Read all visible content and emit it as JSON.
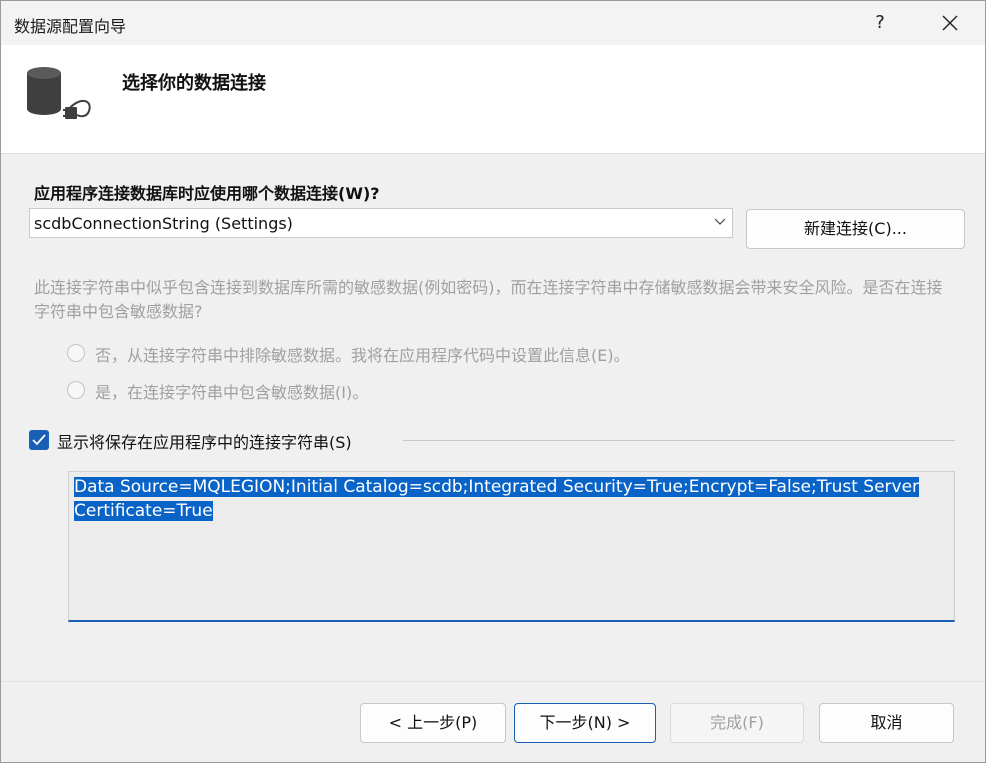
{
  "window": {
    "title": "数据源配置向导",
    "help_label": "?"
  },
  "header": {
    "title": "选择你的数据连接",
    "icon": "database-plug-icon"
  },
  "connection": {
    "question": "应用程序连接数据库时应使用哪个数据连接(W)?",
    "selected": "scdbConnectionString (Settings)",
    "new_button": "新建连接(C)..."
  },
  "sensitive": {
    "warning": "此连接字符串中似乎包含连接到数据库所需的敏感数据(例如密码)，而在连接字符串中存储敏感数据会带来安全风险。是否在连接字符串中包含敏感数据?",
    "options": [
      "否，从连接字符串中排除敏感数据。我将在应用程序代码中设置此信息(E)。",
      "是，在连接字符串中包含敏感数据(I)。"
    ]
  },
  "show_string": {
    "label": "显示将保存在应用程序中的连接字符串(S)",
    "checked": true,
    "line1": "Data Source=MQLEGION;Initial Catalog=scdb;Integrated Security=True;Encrypt=False;Trust Server",
    "line2": "Certificate=True"
  },
  "buttons": {
    "prev": "< 上一步(P)",
    "next": "下一步(N) >",
    "finish": "完成(F)",
    "cancel": "取消"
  },
  "colors": {
    "accent": "#1a5fb4",
    "selection": "#0a64c8",
    "disabled_text": "#a0a0a0"
  }
}
